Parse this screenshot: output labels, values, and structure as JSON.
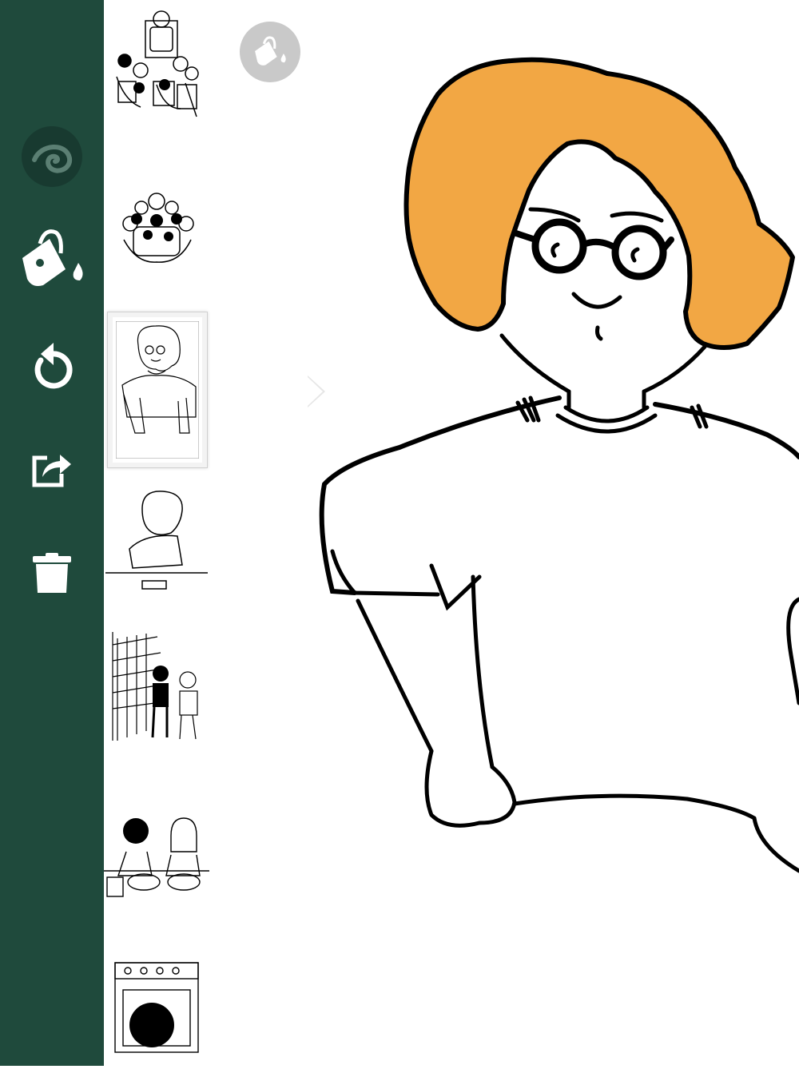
{
  "colors": {
    "sidebar": "#1f4a3c",
    "hair_fill": "#f2a744",
    "ink": "#000000",
    "fab": "#c9c9c9"
  },
  "toolbar": {
    "tools": [
      {
        "name": "spiral-logo-icon"
      },
      {
        "name": "paint-bucket-icon"
      },
      {
        "name": "undo-icon"
      },
      {
        "name": "share-icon"
      },
      {
        "name": "trash-icon"
      }
    ]
  },
  "pages": {
    "selected_index": 2,
    "count": 7
  },
  "canvas": {
    "current_tool": "paint-bucket-icon"
  }
}
